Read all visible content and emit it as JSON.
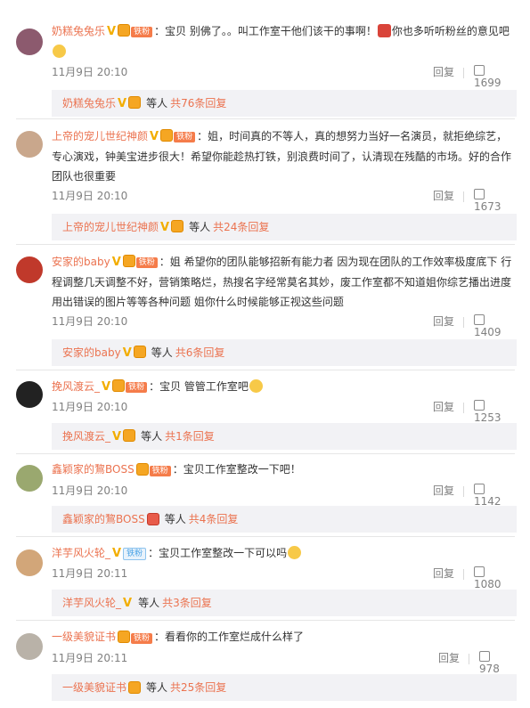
{
  "comments": [
    {
      "username": "奶糕兔兔乐",
      "fan_badge": "铁粉",
      "text": "：宝贝 别佛了。。叫工作室干他们该干的事啊！",
      "text2": "你也多听听粉丝的意见吧",
      "date": "11月9日 20:10",
      "reply_label": "回复",
      "likes": "1699",
      "sub_name": "奶糕兔兔乐",
      "sub_etc": "等人",
      "sub_count": "共76条回复"
    },
    {
      "username": "上帝的宠儿世纪神颜",
      "fan_badge": "铁粉",
      "text": "：姐，时间真的不等人，真的想努力当好一名演员，就拒绝综艺，专心演戏，钟美宝进步很大！希望你能趁热打铁，别浪费时间了，认清现在残酷的市场。好的合作团队也很重要",
      "date": "11月9日 20:10",
      "reply_label": "回复",
      "likes": "1673",
      "sub_name": "上帝的宠儿世纪神颜",
      "sub_etc": "等人",
      "sub_count": "共24条回复"
    },
    {
      "username": "安家的baby",
      "fan_badge": "铁粉",
      "text": "：姐 希望你的团队能够招新有能力者 因为现在团队的工作效率极度底下 行程调整几天调整不好，营销策略烂，热搜名字经常莫名其妙，废工作室都不知道姐你综艺播出进度用出错误的图片等等各种问题 姐你什么时候能够正视这些问题",
      "date": "11月9日 20:10",
      "reply_label": "回复",
      "likes": "1409",
      "sub_name": "安家的baby",
      "sub_etc": "等人",
      "sub_count": "共6条回复"
    },
    {
      "username": "挽风渡云_",
      "fan_badge": "铁粉",
      "text": "：宝贝 管管工作室吧",
      "date": "11月9日 20:10",
      "reply_label": "回复",
      "likes": "1253",
      "sub_name": "挽风渡云_",
      "sub_etc": "等人",
      "sub_count": "共1条回复"
    },
    {
      "username": "鑫颖家的鵹BOSS",
      "fan_badge": "铁粉",
      "text": "：宝贝工作室整改一下吧！",
      "date": "11月9日 20:10",
      "reply_label": "回复",
      "likes": "1142",
      "sub_name": "鑫颖家的鵹BOSS",
      "sub_etc": "等人",
      "sub_count": "共4条回复"
    },
    {
      "username": "洋芋风火轮_",
      "fan_badge": "铁粉",
      "text": "：宝贝工作室整改一下可以吗",
      "date": "11月9日 20:11",
      "reply_label": "回复",
      "likes": "1080",
      "sub_name": "洋芋风火轮_",
      "sub_etc": "等人",
      "sub_count": "共3条回复"
    },
    {
      "username": "一级美貌证书",
      "fan_badge": "铁粉",
      "text": "：看看你的工作室烂成什么样了",
      "date": "11月9日 20:11",
      "reply_label": "回复",
      "likes": "978",
      "sub_name": "一级美貌证书",
      "sub_etc": "等人",
      "sub_count": "共25条回复"
    }
  ],
  "colors": {
    "username": "#eb7350",
    "muted": "#808080",
    "sub_bg": "#f2f2f5",
    "v_badge": "#f2ad00"
  },
  "icons": [
    "v-badge-icon",
    "fan-medal-icon",
    "emoji-icon",
    "like-thumb-icon"
  ]
}
